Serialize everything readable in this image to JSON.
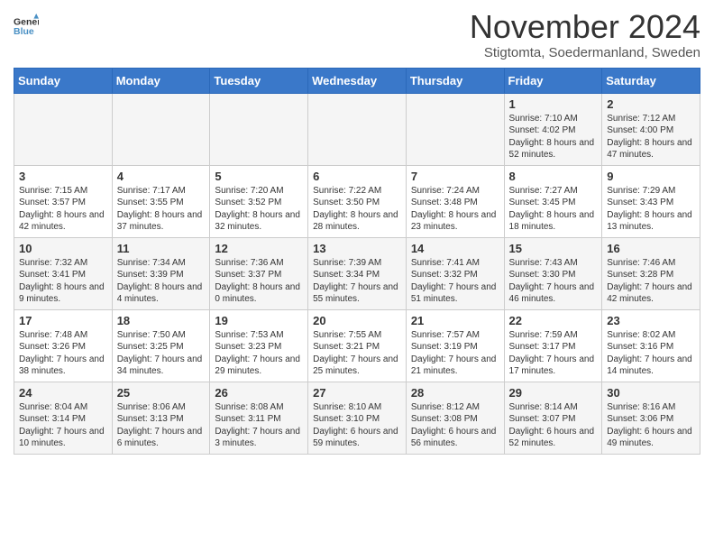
{
  "header": {
    "logo_line1": "General",
    "logo_line2": "Blue",
    "month_title": "November 2024",
    "subtitle": "Stigtomta, Soedermanland, Sweden"
  },
  "days_of_week": [
    "Sunday",
    "Monday",
    "Tuesday",
    "Wednesday",
    "Thursday",
    "Friday",
    "Saturday"
  ],
  "weeks": [
    [
      {
        "day": "",
        "info": ""
      },
      {
        "day": "",
        "info": ""
      },
      {
        "day": "",
        "info": ""
      },
      {
        "day": "",
        "info": ""
      },
      {
        "day": "",
        "info": ""
      },
      {
        "day": "1",
        "info": "Sunrise: 7:10 AM\nSunset: 4:02 PM\nDaylight: 8 hours and 52 minutes."
      },
      {
        "day": "2",
        "info": "Sunrise: 7:12 AM\nSunset: 4:00 PM\nDaylight: 8 hours and 47 minutes."
      }
    ],
    [
      {
        "day": "3",
        "info": "Sunrise: 7:15 AM\nSunset: 3:57 PM\nDaylight: 8 hours and 42 minutes."
      },
      {
        "day": "4",
        "info": "Sunrise: 7:17 AM\nSunset: 3:55 PM\nDaylight: 8 hours and 37 minutes."
      },
      {
        "day": "5",
        "info": "Sunrise: 7:20 AM\nSunset: 3:52 PM\nDaylight: 8 hours and 32 minutes."
      },
      {
        "day": "6",
        "info": "Sunrise: 7:22 AM\nSunset: 3:50 PM\nDaylight: 8 hours and 28 minutes."
      },
      {
        "day": "7",
        "info": "Sunrise: 7:24 AM\nSunset: 3:48 PM\nDaylight: 8 hours and 23 minutes."
      },
      {
        "day": "8",
        "info": "Sunrise: 7:27 AM\nSunset: 3:45 PM\nDaylight: 8 hours and 18 minutes."
      },
      {
        "day": "9",
        "info": "Sunrise: 7:29 AM\nSunset: 3:43 PM\nDaylight: 8 hours and 13 minutes."
      }
    ],
    [
      {
        "day": "10",
        "info": "Sunrise: 7:32 AM\nSunset: 3:41 PM\nDaylight: 8 hours and 9 minutes."
      },
      {
        "day": "11",
        "info": "Sunrise: 7:34 AM\nSunset: 3:39 PM\nDaylight: 8 hours and 4 minutes."
      },
      {
        "day": "12",
        "info": "Sunrise: 7:36 AM\nSunset: 3:37 PM\nDaylight: 8 hours and 0 minutes."
      },
      {
        "day": "13",
        "info": "Sunrise: 7:39 AM\nSunset: 3:34 PM\nDaylight: 7 hours and 55 minutes."
      },
      {
        "day": "14",
        "info": "Sunrise: 7:41 AM\nSunset: 3:32 PM\nDaylight: 7 hours and 51 minutes."
      },
      {
        "day": "15",
        "info": "Sunrise: 7:43 AM\nSunset: 3:30 PM\nDaylight: 7 hours and 46 minutes."
      },
      {
        "day": "16",
        "info": "Sunrise: 7:46 AM\nSunset: 3:28 PM\nDaylight: 7 hours and 42 minutes."
      }
    ],
    [
      {
        "day": "17",
        "info": "Sunrise: 7:48 AM\nSunset: 3:26 PM\nDaylight: 7 hours and 38 minutes."
      },
      {
        "day": "18",
        "info": "Sunrise: 7:50 AM\nSunset: 3:25 PM\nDaylight: 7 hours and 34 minutes."
      },
      {
        "day": "19",
        "info": "Sunrise: 7:53 AM\nSunset: 3:23 PM\nDaylight: 7 hours and 29 minutes."
      },
      {
        "day": "20",
        "info": "Sunrise: 7:55 AM\nSunset: 3:21 PM\nDaylight: 7 hours and 25 minutes."
      },
      {
        "day": "21",
        "info": "Sunrise: 7:57 AM\nSunset: 3:19 PM\nDaylight: 7 hours and 21 minutes."
      },
      {
        "day": "22",
        "info": "Sunrise: 7:59 AM\nSunset: 3:17 PM\nDaylight: 7 hours and 17 minutes."
      },
      {
        "day": "23",
        "info": "Sunrise: 8:02 AM\nSunset: 3:16 PM\nDaylight: 7 hours and 14 minutes."
      }
    ],
    [
      {
        "day": "24",
        "info": "Sunrise: 8:04 AM\nSunset: 3:14 PM\nDaylight: 7 hours and 10 minutes."
      },
      {
        "day": "25",
        "info": "Sunrise: 8:06 AM\nSunset: 3:13 PM\nDaylight: 7 hours and 6 minutes."
      },
      {
        "day": "26",
        "info": "Sunrise: 8:08 AM\nSunset: 3:11 PM\nDaylight: 7 hours and 3 minutes."
      },
      {
        "day": "27",
        "info": "Sunrise: 8:10 AM\nSunset: 3:10 PM\nDaylight: 6 hours and 59 minutes."
      },
      {
        "day": "28",
        "info": "Sunrise: 8:12 AM\nSunset: 3:08 PM\nDaylight: 6 hours and 56 minutes."
      },
      {
        "day": "29",
        "info": "Sunrise: 8:14 AM\nSunset: 3:07 PM\nDaylight: 6 hours and 52 minutes."
      },
      {
        "day": "30",
        "info": "Sunrise: 8:16 AM\nSunset: 3:06 PM\nDaylight: 6 hours and 49 minutes."
      }
    ]
  ]
}
